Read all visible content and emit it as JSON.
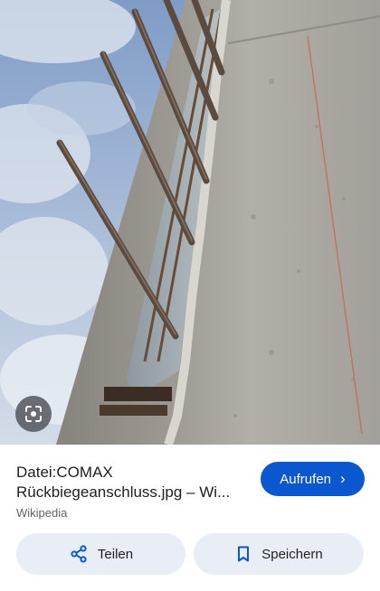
{
  "result": {
    "title_line1": "Datei:COMAX",
    "title_line2": "Rückbiegeanschluss.jpg – Wi...",
    "source": "Wikipedia",
    "visit_label": "Aufrufen",
    "visit_chevron": "›"
  },
  "actions": {
    "share_label": "Teilen",
    "save_label": "Speichern"
  },
  "icons": {
    "lens": "lens-icon",
    "share": "share-icon",
    "bookmark": "bookmark-icon",
    "chevron": "chevron-right-icon"
  },
  "colors": {
    "accent": "#0b57d0",
    "pill_background": "#e9eef6",
    "text_primary": "#1f1f1f",
    "text_secondary": "#5f6368"
  }
}
